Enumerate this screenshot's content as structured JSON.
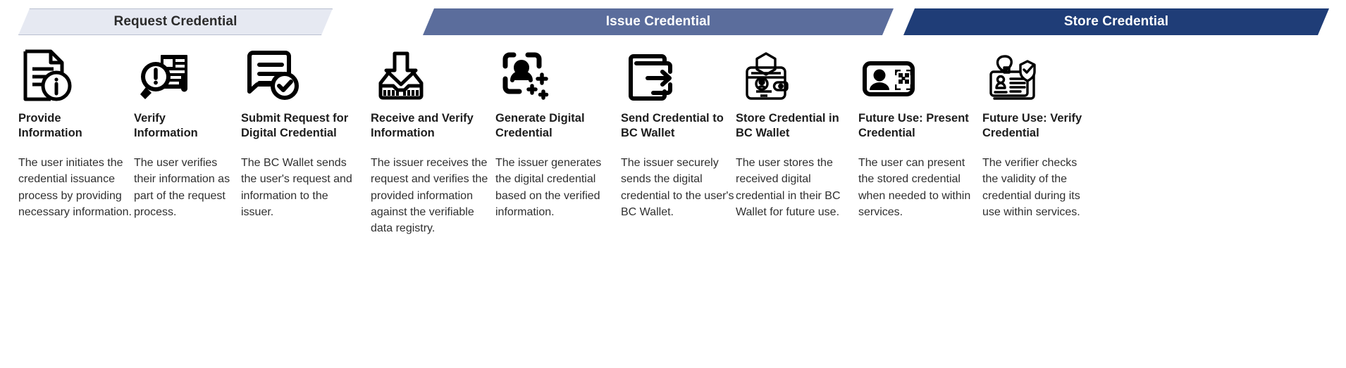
{
  "banners": [
    {
      "id": "request",
      "label": "Request Credential",
      "fill": "#e6e9f2",
      "text_color": "#2b2b2b",
      "border": "#b9bfd0"
    },
    {
      "id": "issue",
      "label": "Issue Credential",
      "fill": "#5b6d9c",
      "text_color": "#ffffff",
      "border": "none"
    },
    {
      "id": "store",
      "label": "Store Credential",
      "fill": "#1f3d77",
      "text_color": "#ffffff",
      "border": "none"
    }
  ],
  "steps": [
    {
      "phase": "request",
      "icon": "document-info-icon",
      "title": "Provide\nInformation",
      "body": "The user initiates the credential issuance process by providing necessary information."
    },
    {
      "phase": "request",
      "icon": "magnifier-alert-document-icon",
      "title": "Verify\nInformation",
      "body": "The user verifies their information as part of the request process."
    },
    {
      "phase": "request",
      "icon": "document-check-icon",
      "title": "Submit Request for\nDigital Credential",
      "body": "The BC Wallet sends the user's request and information to the issuer."
    },
    {
      "phase": "issue",
      "icon": "inbox-download-icon",
      "title": "Receive and Verify\nInformation",
      "body": "The issuer receives the request and verifies the provided information against the verifiable data registry."
    },
    {
      "phase": "issue",
      "icon": "id-card-sparkle-icon",
      "title": "Generate Digital\nCredential",
      "body": "The issuer generates the digital credential based on the verified information."
    },
    {
      "phase": "issue",
      "icon": "wallet-arrow-out-icon",
      "title": "Send Credential to\nBC Wallet",
      "body": "The issuer securely sends the digital credential to the user's BC Wallet."
    },
    {
      "phase": "store",
      "icon": "wallet-id-hex-icon",
      "title": "Store Credential in\nBC Wallet",
      "body": "The user stores the received digital credential in their BC Wallet for future use."
    },
    {
      "phase": "store",
      "icon": "id-card-qr-icon",
      "title": "Future Use: Present\nCredential",
      "body": "The user can present the stored credential when needed to within services."
    },
    {
      "phase": "store",
      "icon": "badge-lanyard-verified-icon",
      "title": "Future Use: Verify\nCredential",
      "body": "The verifier checks the validity of the credential during its use within services."
    }
  ]
}
